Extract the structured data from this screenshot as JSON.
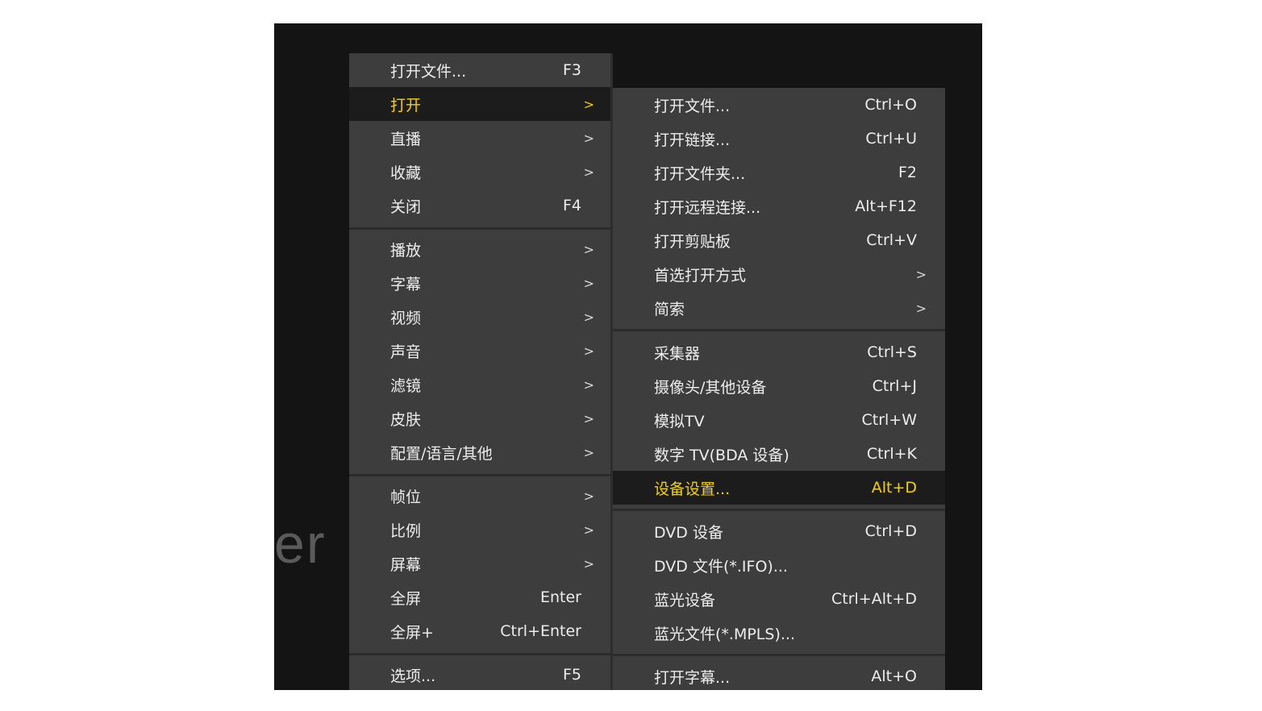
{
  "background_text": "er",
  "main_menu": {
    "items": [
      {
        "label": "打开文件...",
        "shortcut": "F3",
        "arrow": ""
      },
      {
        "label": "打开",
        "shortcut": "",
        "arrow": ">"
      },
      {
        "label": "直播",
        "shortcut": "",
        "arrow": ">"
      },
      {
        "label": "收藏",
        "shortcut": "",
        "arrow": ">"
      },
      {
        "label": "关闭",
        "shortcut": "F4",
        "arrow": ""
      },
      {
        "label": "播放",
        "shortcut": "",
        "arrow": ">"
      },
      {
        "label": "字幕",
        "shortcut": "",
        "arrow": ">"
      },
      {
        "label": "视频",
        "shortcut": "",
        "arrow": ">"
      },
      {
        "label": "声音",
        "shortcut": "",
        "arrow": ">"
      },
      {
        "label": "滤镜",
        "shortcut": "",
        "arrow": ">"
      },
      {
        "label": "皮肤",
        "shortcut": "",
        "arrow": ">"
      },
      {
        "label": "配置/语言/其他",
        "shortcut": "",
        "arrow": ">"
      },
      {
        "label": "帧位",
        "shortcut": "",
        "arrow": ">"
      },
      {
        "label": "比例",
        "shortcut": "",
        "arrow": ">"
      },
      {
        "label": "屏幕",
        "shortcut": "",
        "arrow": ">"
      },
      {
        "label": "全屏",
        "shortcut": "Enter",
        "arrow": ""
      },
      {
        "label": "全屏+",
        "shortcut": "Ctrl+Enter",
        "arrow": ""
      },
      {
        "label": "选项...",
        "shortcut": "F5",
        "arrow": ""
      }
    ]
  },
  "sub_menu": {
    "items": [
      {
        "label": "打开文件...",
        "shortcut": "Ctrl+O",
        "arrow": ""
      },
      {
        "label": "打开链接...",
        "shortcut": "Ctrl+U",
        "arrow": ""
      },
      {
        "label": "打开文件夹...",
        "shortcut": "F2",
        "arrow": ""
      },
      {
        "label": "打开远程连接...",
        "shortcut": "Alt+F12",
        "arrow": ""
      },
      {
        "label": "打开剪贴板",
        "shortcut": "Ctrl+V",
        "arrow": ""
      },
      {
        "label": "首选打开方式",
        "shortcut": "",
        "arrow": ">"
      },
      {
        "label": "简索",
        "shortcut": "",
        "arrow": ">"
      },
      {
        "label": "采集器",
        "shortcut": "Ctrl+S",
        "arrow": ""
      },
      {
        "label": "摄像头/其他设备",
        "shortcut": "Ctrl+J",
        "arrow": ""
      },
      {
        "label": "模拟TV",
        "shortcut": "Ctrl+W",
        "arrow": ""
      },
      {
        "label": "数字 TV(BDA 设备)",
        "shortcut": "Ctrl+K",
        "arrow": ""
      },
      {
        "label": "设备设置...",
        "shortcut": "Alt+D",
        "arrow": ""
      },
      {
        "label": "DVD 设备",
        "shortcut": "Ctrl+D",
        "arrow": ""
      },
      {
        "label": "DVD 文件(*.IFO)...",
        "shortcut": "",
        "arrow": ""
      },
      {
        "label": "蓝光设备",
        "shortcut": "Ctrl+Alt+D",
        "arrow": ""
      },
      {
        "label": "蓝光文件(*.MPLS)...",
        "shortcut": "",
        "arrow": ""
      },
      {
        "label": "打开字幕...",
        "shortcut": "Alt+O",
        "arrow": ""
      }
    ]
  },
  "colors": {
    "highlight_text": "#f5d000",
    "menu_bg": "#3d3d3d",
    "active_bg": "#1c1c1c"
  }
}
